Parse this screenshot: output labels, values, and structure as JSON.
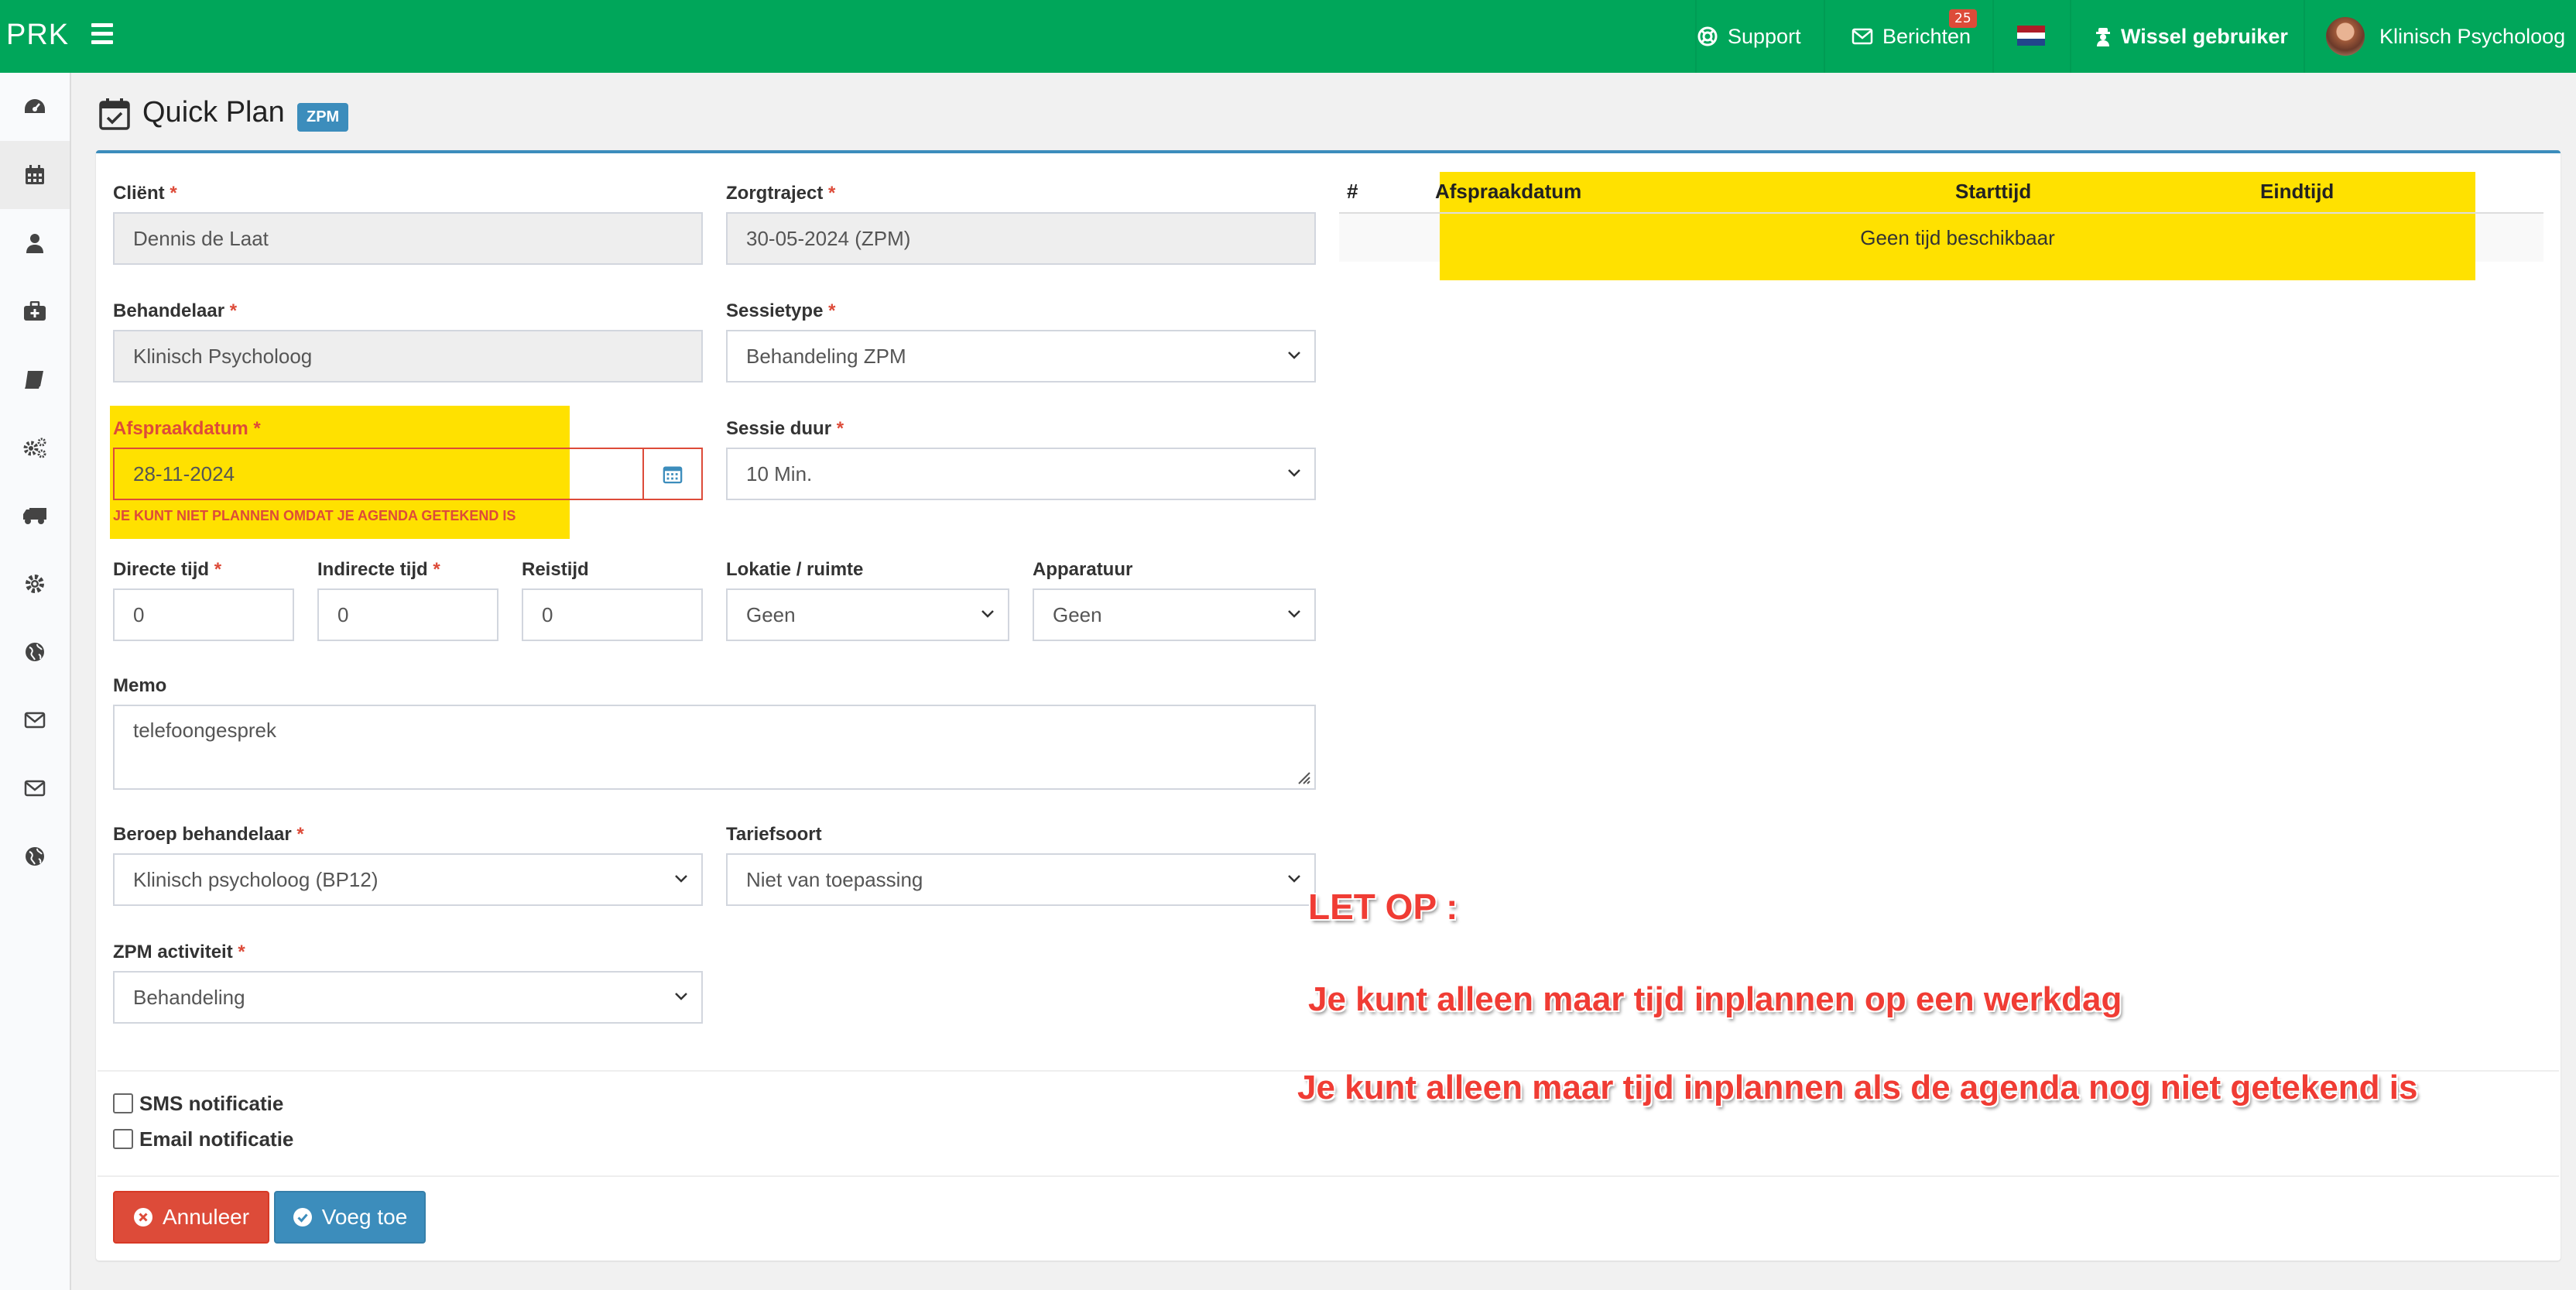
{
  "app": {
    "brand": "PRK"
  },
  "topbar": {
    "support": "Support",
    "messages": "Berichten",
    "messages_count": "25",
    "switch_user": "Wissel gebruiker",
    "user_name": "Klinisch Psycholoog"
  },
  "sidebar": {
    "items": [
      "dashboard-icon",
      "calendar-icon",
      "user-icon",
      "medkit-icon",
      "book-icon",
      "cogs-icon",
      "truck-icon",
      "gear-icon",
      "globe-icon",
      "envelope-icon",
      "envelope-icon",
      "globe-icon"
    ]
  },
  "page": {
    "title": "Quick Plan",
    "badge": "ZPM"
  },
  "form": {
    "client": {
      "label": "Cliënt",
      "required": "*",
      "value": "Dennis de Laat"
    },
    "zorgtraject": {
      "label": "Zorgtraject",
      "required": "*",
      "value": "30-05-2024 (ZPM)"
    },
    "behandelaar": {
      "label": "Behandelaar",
      "required": "*",
      "value": "Klinisch Psycholoog"
    },
    "sessietype": {
      "label": "Sessietype",
      "required": "*",
      "value": "Behandeling ZPM"
    },
    "afspraakdatum": {
      "label": "Afspraakdatum",
      "required": "*",
      "value": "28-11-2024",
      "error": "JE KUNT NIET PLANNEN OMDAT JE AGENDA GETEKEND IS"
    },
    "sessie_duur": {
      "label": "Sessie duur",
      "required": "*",
      "value": "10 Min."
    },
    "directe_tijd": {
      "label": "Directe tijd",
      "required": "*",
      "value": "0"
    },
    "indirecte_tijd": {
      "label": "Indirecte tijd",
      "required": "*",
      "value": "0"
    },
    "reistijd": {
      "label": "Reistijd",
      "value": "0"
    },
    "lokatie": {
      "label": "Lokatie / ruimte",
      "value": "Geen"
    },
    "apparatuur": {
      "label": "Apparatuur",
      "value": "Geen"
    },
    "memo": {
      "label": "Memo",
      "value": "telefoongesprek"
    },
    "beroep": {
      "label": "Beroep behandelaar",
      "required": "*",
      "value": "Klinisch psycholoog (BP12)"
    },
    "tariefsoort": {
      "label": "Tariefsoort",
      "value": "Niet van toepassing"
    },
    "zpm_activiteit": {
      "label": "ZPM activiteit",
      "required": "*",
      "value": "Behandeling"
    },
    "sms": {
      "label": "SMS notificatie",
      "checked": false
    },
    "email": {
      "label": "Email notificatie",
      "checked": false
    },
    "cancel_label": "Annuleer",
    "submit_label": "Voeg toe"
  },
  "table": {
    "headers": [
      "#",
      "Afspraakdatum",
      "Starttijd",
      "Eindtijd"
    ],
    "empty_message": "Geen tijd beschikbaar"
  },
  "annotation": {
    "heading": "LET OP :",
    "line1": "Je kunt alleen maar tijd inplannen op een werkdag",
    "line2": "Je kunt alleen maar tijd inplannen als de agenda nog niet getekend is"
  },
  "colors": {
    "topbar": "#00a65a",
    "primary": "#3c8dbc",
    "danger": "#dd4b39",
    "highlight": "#ffe100",
    "note_text": "#f03c34"
  }
}
